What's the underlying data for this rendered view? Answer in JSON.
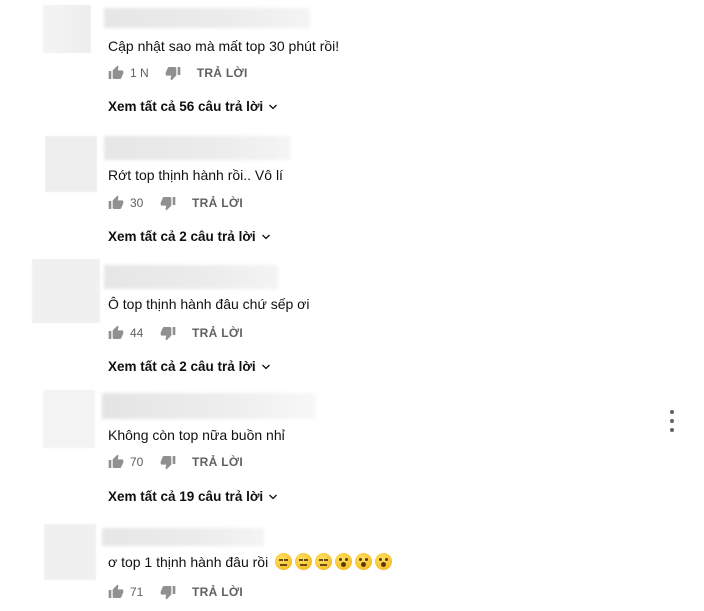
{
  "comments": [
    {
      "text": "Cập nhật sao mà mất top 30 phút rồi!",
      "likes": "1 N",
      "reply_label": "TRẢ LỜI",
      "view_replies": "Xem tất cả 56 câu trả lời",
      "emojis": []
    },
    {
      "text": "Rớt top thịnh hành rồi.. Vô lí",
      "likes": "30",
      "reply_label": "TRẢ LỜI",
      "view_replies": "Xem tất cả 2 câu trả lời",
      "emojis": []
    },
    {
      "text": "Ô top thịnh hành đâu chứ sếp ơi",
      "likes": "44",
      "reply_label": "TRẢ LỜI",
      "view_replies": "Xem tất cả 2 câu trả lời",
      "emojis": []
    },
    {
      "text": "Không còn top nữa buồn nhỉ",
      "likes": "70",
      "reply_label": "TRẢ LỜI",
      "view_replies": "Xem tất cả 19 câu trả lời",
      "emojis": []
    },
    {
      "text": "ơ top 1 thịnh hành đâu rồi",
      "likes": "71",
      "reply_label": "TRẢ LỜI",
      "view_replies": "",
      "emojis": [
        "expressionless-face",
        "expressionless-face",
        "expressionless-face",
        "astonished-face",
        "astonished-face",
        "astonished-face"
      ]
    }
  ],
  "icons": {
    "like": "thumbs-up-icon",
    "dislike": "thumbs-down-icon",
    "expand": "chevron-down-icon",
    "menu": "more-vertical-icon"
  },
  "colors": {
    "text": "#111111",
    "meta": "#606060",
    "avatar_placeholder": "#eeeeee"
  }
}
